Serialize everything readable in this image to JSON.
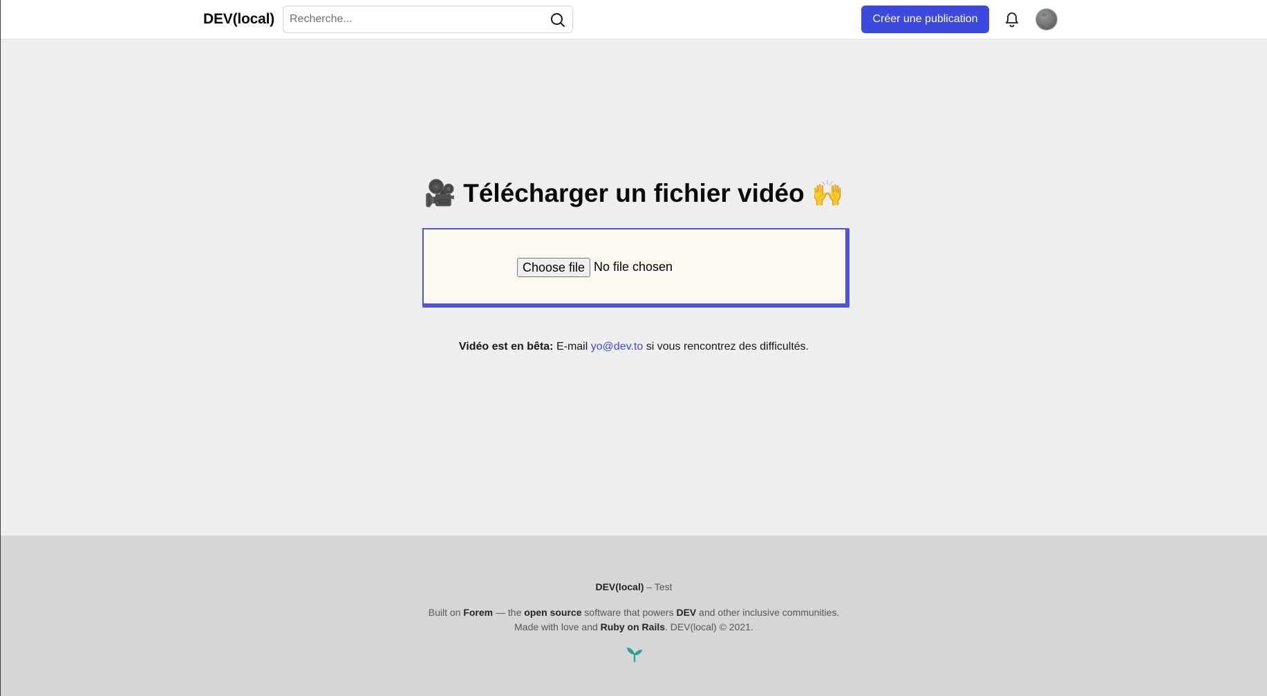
{
  "header": {
    "logo": "DEV(local)",
    "search_placeholder": "Recherche...",
    "create_button": "Créer une publication",
    "icons": {
      "search": "search-icon",
      "bell": "bell-icon",
      "avatar": "avatar"
    }
  },
  "main": {
    "title_emoji_left": "🎥",
    "title": "Télécharger un fichier vidéo",
    "title_emoji_right": "🙌",
    "file_button": "Choose file",
    "file_status": "No file chosen",
    "beta_bold": "Vidéo est en bêta:",
    "beta_prefix": "E-mail",
    "beta_email": "yo@dev.to",
    "beta_suffix": "si vous rencontrez des difficultés."
  },
  "footer": {
    "site_name": "DEV(local)",
    "site_suffix": "– Test",
    "built_on": "Built on",
    "forem": "Forem",
    "the": "— the",
    "open_source": "open source",
    "software_that_powers": "software that powers",
    "dev": "DEV",
    "and_other": "and other inclusive communities.",
    "made_with": "Made with love and",
    "ruby_on_rails": "Ruby on Rails",
    "copyright": ". DEV(local) © 2021."
  },
  "colors": {
    "accent": "#3b49df",
    "upload_border": "#4a52e8",
    "upload_bg": "#fdf9f3",
    "footer_bg": "#d6d6d6",
    "page_bg": "#efefef",
    "forem_logo": "#26a69a"
  }
}
